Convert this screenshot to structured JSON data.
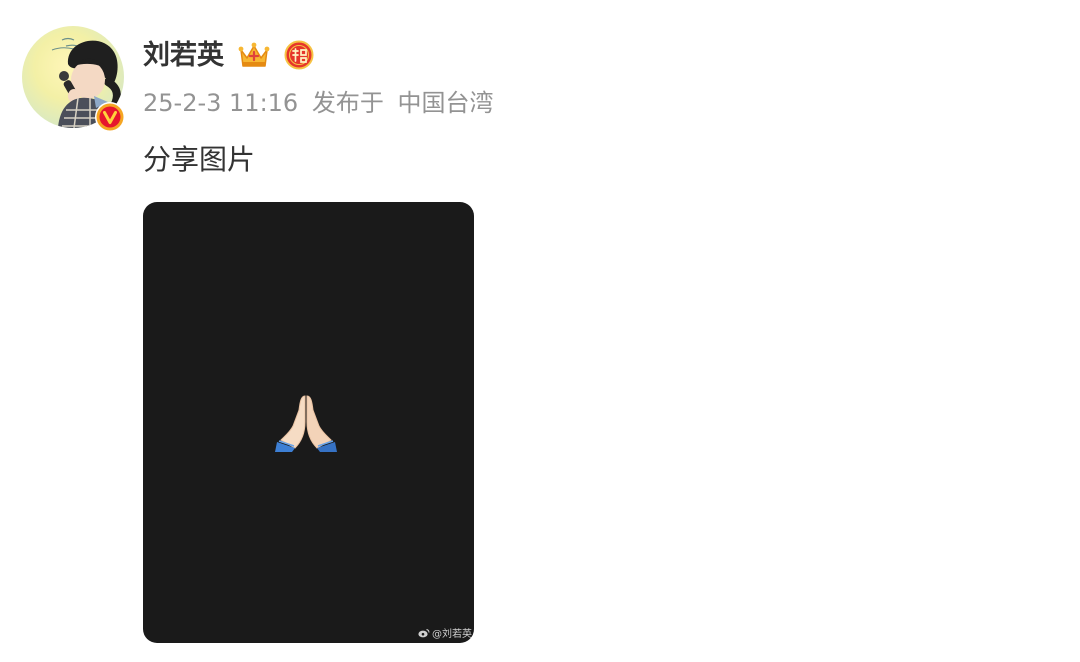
{
  "post": {
    "author": {
      "name": "刘若英",
      "avatar_icon": "avatar-illustration",
      "verified_icon": "verified-v-icon",
      "badges": [
        "crown-icon",
        "fortune-icon"
      ]
    },
    "date": "25-2-3 11:16",
    "published_label": "发布于",
    "location": "中国台湾",
    "text": "分享图片",
    "image": {
      "emoji": "folded-hands-icon",
      "background": "#1a1a1a",
      "watermark": "@刘若英"
    }
  },
  "colors": {
    "text_primary": "#333333",
    "text_meta": "#939393",
    "verified_orange": "#f5a623",
    "verified_red": "#e6162d"
  }
}
